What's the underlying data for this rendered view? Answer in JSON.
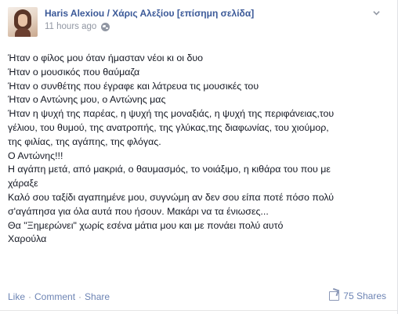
{
  "post": {
    "author": "Haris Alexiou / Χάρις Αλεξίου [επίσημη σελίδα]",
    "timestamp": "11 hours ago",
    "privacy_icon": "globe-icon",
    "options_icon": "chevron-down-icon",
    "lines": [
      "Ήταν ο φίλος μου όταν ήμασταν νέοι κι οι δυο",
      "Ήταν ο μουσικός που θαύμαζα",
      "Ήταν ο συνθέτης που έγραφε και λάτρευα τις μουσικές του",
      "Ήταν ο Αντώνης μου, ο Αντώνης μας",
      "Ήταν η ψυχή της παρέας, η ψυχή της μοναξιάς, η ψυχή της περιφάνειας,του",
      "γέλιου, του θυμού, της ανατροπής, της γλύκας,της διαφωνίας, του χιούμορ,",
      "της φιλίας, της αγάπης, της φλόγας.",
      "Ο Αντώνης!!!",
      "Η αγάπη μετά, από μακριά, ο θαυμασμός, το νοιάξιμο, η κιθάρα του που με",
      "χάραξε",
      "Καλό σου ταξίδι αγαπημένε μου, συγνώμη αν δεν σου είπα ποτέ πόσο πολύ",
      "σ'αγάπησα για όλα αυτά που ήσουν. Μακάρι να τα ένιωσες...",
      "Θα \"Ξημερώνει\" χωρίς εσένα μάτια μου και με πονάει πολύ αυτό",
      "Χαρούλα"
    ]
  },
  "footer": {
    "like_label": "Like",
    "comment_label": "Comment",
    "share_label": "Share",
    "separator": "·",
    "shares_count_label": "75 Shares",
    "shares_icon": "share-icon"
  },
  "colors": {
    "link": "#3b5998",
    "meta": "#9197a3",
    "text": "#141823",
    "action": "#6d84b4"
  }
}
